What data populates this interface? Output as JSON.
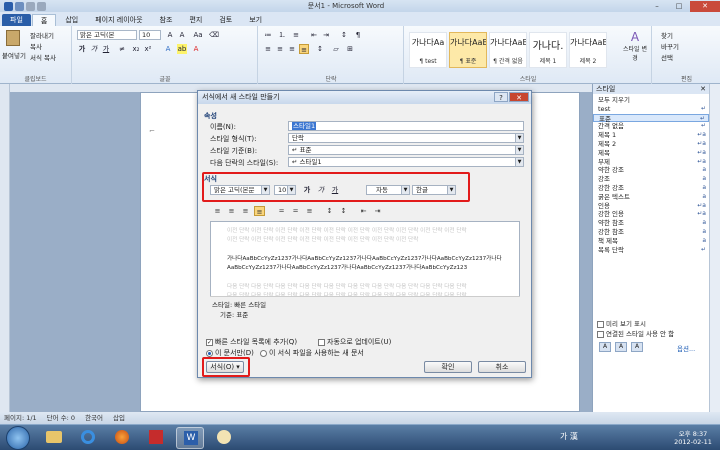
{
  "window": {
    "title": "문서1 - Microsoft Word",
    "min": "–",
    "max": "□",
    "close": "✕"
  },
  "tabs": [
    {
      "label": "파일"
    },
    {
      "label": "홈"
    },
    {
      "label": "삽입"
    },
    {
      "label": "페이지 레이아웃"
    },
    {
      "label": "참조"
    },
    {
      "label": "편지"
    },
    {
      "label": "검토"
    },
    {
      "label": "보기"
    }
  ],
  "ribbon": {
    "clipboard": {
      "label": "클립보드",
      "paste": "붙여넣기",
      "cut": "잘라내기",
      "copy": "복사",
      "format_painter": "서식 복사"
    },
    "font": {
      "label": "글꼴",
      "font_name": "맑은 고딕(본",
      "font_size": "10"
    },
    "paragraph": {
      "label": "단락"
    },
    "styles": {
      "label": "스타일",
      "cards": [
        {
          "sample": "가나다Aa",
          "name": "¶ test"
        },
        {
          "sample": "가나다AaE",
          "name": "¶ 표준"
        },
        {
          "sample": "가나다AaE",
          "name": "¶ 간격 없음"
        },
        {
          "sample": "가나다.",
          "name": "제목 1"
        },
        {
          "sample": "가나다AaE",
          "name": "제목 2"
        }
      ],
      "change_styles": "스타일 변경"
    },
    "editing": {
      "label": "편집",
      "find": "찾기",
      "replace": "바꾸기",
      "select": "선택"
    }
  },
  "styles_pane": {
    "title": "스타일",
    "items": [
      {
        "label": "모두 지우기",
        "mark": ""
      },
      {
        "label": "test",
        "mark": "↵"
      },
      {
        "label": "표준",
        "mark": "↵",
        "selected": true
      },
      {
        "label": "간격 없음",
        "mark": "↵"
      },
      {
        "label": "제목 1",
        "mark": "↵a"
      },
      {
        "label": "제목 2",
        "mark": "↵a"
      },
      {
        "label": "제목",
        "mark": "↵a"
      },
      {
        "label": "부제",
        "mark": "↵a"
      },
      {
        "label": "약한 강조",
        "mark": "a"
      },
      {
        "label": "강조",
        "mark": "a"
      },
      {
        "label": "강한 강조",
        "mark": "a"
      },
      {
        "label": "굵은 텍스트",
        "mark": "a"
      },
      {
        "label": "인용",
        "mark": "↵a"
      },
      {
        "label": "강한 인용",
        "mark": "↵a"
      },
      {
        "label": "약한 참조",
        "mark": "a"
      },
      {
        "label": "강한 참조",
        "mark": "a"
      },
      {
        "label": "책 제목",
        "mark": "a"
      },
      {
        "label": "목록 단락",
        "mark": "↵"
      }
    ],
    "show_preview": "미리 보기 표시",
    "disable_linked": "연결된 스타일 사용 안 함",
    "options": "옵션..."
  },
  "dialog": {
    "title": "서식에서 새 스타일 만들기",
    "section_props": "속성",
    "name_label": "이름(N):",
    "name_value": "스타일1",
    "type_label": "스타일 형식(T):",
    "type_value": "단락",
    "based_label": "스타일 기준(B):",
    "based_value": "↵ 표준",
    "next_label": "다음 단락의 스타일(S):",
    "next_value": "↵ 스타일1",
    "section_format": "서식",
    "font_value": "맑은 고딕(본문",
    "size_value": "10",
    "bold": "가",
    "italic": "가",
    "underline": "가",
    "color_value": "자동",
    "lang_value": "한글",
    "preview_prev": "이전 단락 이전 단락 이전 단락 이전 단락 이전 단락 이전 단락 이전 단락 이전 단락 이전 단락 이전 단락",
    "preview_prev2": "이전 단락 이전 단락 이전 단락 이전 단락 이전 단락 이전 단락 이전 단락 이전 단락",
    "preview_line1": "가나다AaBbCcYyZz1237가나다AaBbCcYyZz1237가나다AaBbCcYyZz1237가나다AaBbCcYyZz1237가나다",
    "preview_line2": "AaBbCcYyZz1237가나다AaBbCcYyZz1237가나다AaBbCcYyZz1237가나다AaBbCcYyZz123",
    "preview_next": "다음 단락 다음 단락 다음 단락 다음 단락 다음 단락 다음 단락 다음 단락 다음 단락 다음 단락 다음 단락",
    "desc_line1": "스타일: 빠른 스타일",
    "desc_line2": "기준: 표준",
    "add_quick": "빠른 스타일 목록에 추가(Q)",
    "auto_update": "자동으로 업데이트(U)",
    "only_doc": "이 문서만(D)",
    "new_docs": "이 서식 파일을 사용하는 새 문서",
    "format_btn": "서식(O) ▾",
    "ok": "확인",
    "cancel": "취소"
  },
  "status": {
    "page": "페이지: 1/1",
    "words": "단어 수: 0",
    "lang": "한국어",
    "mode": "삽입"
  },
  "taskbar": {
    "ime": "가 漢",
    "time": "오후 8:37",
    "date": "2012-02-11"
  }
}
